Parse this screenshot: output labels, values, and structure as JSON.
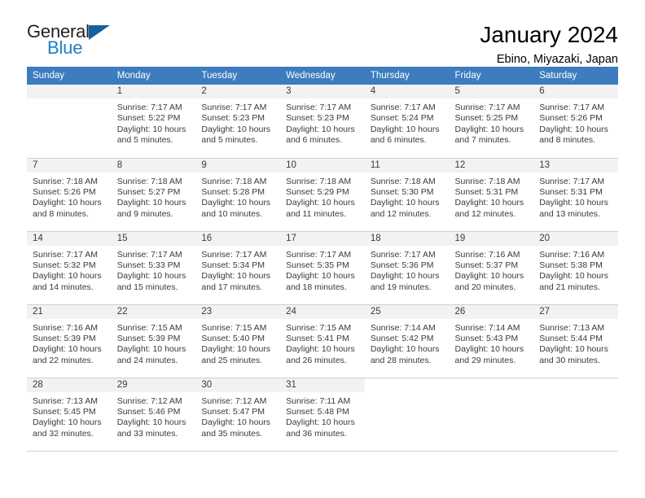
{
  "brand": {
    "word_one": "General",
    "word_two": "Blue",
    "triangle_icon": "triangle-icon"
  },
  "header": {
    "title": "January 2024",
    "subtitle": "Ebino, Miyazaki, Japan"
  },
  "colors": {
    "header_blue": "#3d7cbf",
    "brand_blue": "#1f7fc4",
    "brand_dark": "#231f20",
    "daynum_band": "#f2f2f2",
    "grid_line": "#cfcfcf",
    "text": "#3a3a3a"
  },
  "weekday_headers": [
    "Sunday",
    "Monday",
    "Tuesday",
    "Wednesday",
    "Thursday",
    "Friday",
    "Saturday"
  ],
  "labels": {
    "sunrise_prefix": "Sunrise:",
    "sunset_prefix": "Sunset:",
    "daylight_prefix": "Daylight:"
  },
  "weeks": [
    [
      {
        "day": "",
        "blank": true,
        "sunrise": "",
        "sunset": "",
        "daylight_line1": "",
        "daylight_line2": ""
      },
      {
        "day": "1",
        "sunrise": "Sunrise: 7:17 AM",
        "sunset": "Sunset: 5:22 PM",
        "daylight_line1": "Daylight: 10 hours",
        "daylight_line2": "and 5 minutes."
      },
      {
        "day": "2",
        "sunrise": "Sunrise: 7:17 AM",
        "sunset": "Sunset: 5:23 PM",
        "daylight_line1": "Daylight: 10 hours",
        "daylight_line2": "and 5 minutes."
      },
      {
        "day": "3",
        "sunrise": "Sunrise: 7:17 AM",
        "sunset": "Sunset: 5:23 PM",
        "daylight_line1": "Daylight: 10 hours",
        "daylight_line2": "and 6 minutes."
      },
      {
        "day": "4",
        "sunrise": "Sunrise: 7:17 AM",
        "sunset": "Sunset: 5:24 PM",
        "daylight_line1": "Daylight: 10 hours",
        "daylight_line2": "and 6 minutes."
      },
      {
        "day": "5",
        "sunrise": "Sunrise: 7:17 AM",
        "sunset": "Sunset: 5:25 PM",
        "daylight_line1": "Daylight: 10 hours",
        "daylight_line2": "and 7 minutes."
      },
      {
        "day": "6",
        "sunrise": "Sunrise: 7:17 AM",
        "sunset": "Sunset: 5:26 PM",
        "daylight_line1": "Daylight: 10 hours",
        "daylight_line2": "and 8 minutes."
      }
    ],
    [
      {
        "day": "7",
        "sunrise": "Sunrise: 7:18 AM",
        "sunset": "Sunset: 5:26 PM",
        "daylight_line1": "Daylight: 10 hours",
        "daylight_line2": "and 8 minutes."
      },
      {
        "day": "8",
        "sunrise": "Sunrise: 7:18 AM",
        "sunset": "Sunset: 5:27 PM",
        "daylight_line1": "Daylight: 10 hours",
        "daylight_line2": "and 9 minutes."
      },
      {
        "day": "9",
        "sunrise": "Sunrise: 7:18 AM",
        "sunset": "Sunset: 5:28 PM",
        "daylight_line1": "Daylight: 10 hours",
        "daylight_line2": "and 10 minutes."
      },
      {
        "day": "10",
        "sunrise": "Sunrise: 7:18 AM",
        "sunset": "Sunset: 5:29 PM",
        "daylight_line1": "Daylight: 10 hours",
        "daylight_line2": "and 11 minutes."
      },
      {
        "day": "11",
        "sunrise": "Sunrise: 7:18 AM",
        "sunset": "Sunset: 5:30 PM",
        "daylight_line1": "Daylight: 10 hours",
        "daylight_line2": "and 12 minutes."
      },
      {
        "day": "12",
        "sunrise": "Sunrise: 7:18 AM",
        "sunset": "Sunset: 5:31 PM",
        "daylight_line1": "Daylight: 10 hours",
        "daylight_line2": "and 12 minutes."
      },
      {
        "day": "13",
        "sunrise": "Sunrise: 7:17 AM",
        "sunset": "Sunset: 5:31 PM",
        "daylight_line1": "Daylight: 10 hours",
        "daylight_line2": "and 13 minutes."
      }
    ],
    [
      {
        "day": "14",
        "sunrise": "Sunrise: 7:17 AM",
        "sunset": "Sunset: 5:32 PM",
        "daylight_line1": "Daylight: 10 hours",
        "daylight_line2": "and 14 minutes."
      },
      {
        "day": "15",
        "sunrise": "Sunrise: 7:17 AM",
        "sunset": "Sunset: 5:33 PM",
        "daylight_line1": "Daylight: 10 hours",
        "daylight_line2": "and 15 minutes."
      },
      {
        "day": "16",
        "sunrise": "Sunrise: 7:17 AM",
        "sunset": "Sunset: 5:34 PM",
        "daylight_line1": "Daylight: 10 hours",
        "daylight_line2": "and 17 minutes."
      },
      {
        "day": "17",
        "sunrise": "Sunrise: 7:17 AM",
        "sunset": "Sunset: 5:35 PM",
        "daylight_line1": "Daylight: 10 hours",
        "daylight_line2": "and 18 minutes."
      },
      {
        "day": "18",
        "sunrise": "Sunrise: 7:17 AM",
        "sunset": "Sunset: 5:36 PM",
        "daylight_line1": "Daylight: 10 hours",
        "daylight_line2": "and 19 minutes."
      },
      {
        "day": "19",
        "sunrise": "Sunrise: 7:16 AM",
        "sunset": "Sunset: 5:37 PM",
        "daylight_line1": "Daylight: 10 hours",
        "daylight_line2": "and 20 minutes."
      },
      {
        "day": "20",
        "sunrise": "Sunrise: 7:16 AM",
        "sunset": "Sunset: 5:38 PM",
        "daylight_line1": "Daylight: 10 hours",
        "daylight_line2": "and 21 minutes."
      }
    ],
    [
      {
        "day": "21",
        "sunrise": "Sunrise: 7:16 AM",
        "sunset": "Sunset: 5:39 PM",
        "daylight_line1": "Daylight: 10 hours",
        "daylight_line2": "and 22 minutes."
      },
      {
        "day": "22",
        "sunrise": "Sunrise: 7:15 AM",
        "sunset": "Sunset: 5:39 PM",
        "daylight_line1": "Daylight: 10 hours",
        "daylight_line2": "and 24 minutes."
      },
      {
        "day": "23",
        "sunrise": "Sunrise: 7:15 AM",
        "sunset": "Sunset: 5:40 PM",
        "daylight_line1": "Daylight: 10 hours",
        "daylight_line2": "and 25 minutes."
      },
      {
        "day": "24",
        "sunrise": "Sunrise: 7:15 AM",
        "sunset": "Sunset: 5:41 PM",
        "daylight_line1": "Daylight: 10 hours",
        "daylight_line2": "and 26 minutes."
      },
      {
        "day": "25",
        "sunrise": "Sunrise: 7:14 AM",
        "sunset": "Sunset: 5:42 PM",
        "daylight_line1": "Daylight: 10 hours",
        "daylight_line2": "and 28 minutes."
      },
      {
        "day": "26",
        "sunrise": "Sunrise: 7:14 AM",
        "sunset": "Sunset: 5:43 PM",
        "daylight_line1": "Daylight: 10 hours",
        "daylight_line2": "and 29 minutes."
      },
      {
        "day": "27",
        "sunrise": "Sunrise: 7:13 AM",
        "sunset": "Sunset: 5:44 PM",
        "daylight_line1": "Daylight: 10 hours",
        "daylight_line2": "and 30 minutes."
      }
    ],
    [
      {
        "day": "28",
        "sunrise": "Sunrise: 7:13 AM",
        "sunset": "Sunset: 5:45 PM",
        "daylight_line1": "Daylight: 10 hours",
        "daylight_line2": "and 32 minutes."
      },
      {
        "day": "29",
        "sunrise": "Sunrise: 7:12 AM",
        "sunset": "Sunset: 5:46 PM",
        "daylight_line1": "Daylight: 10 hours",
        "daylight_line2": "and 33 minutes."
      },
      {
        "day": "30",
        "sunrise": "Sunrise: 7:12 AM",
        "sunset": "Sunset: 5:47 PM",
        "daylight_line1": "Daylight: 10 hours",
        "daylight_line2": "and 35 minutes."
      },
      {
        "day": "31",
        "sunrise": "Sunrise: 7:11 AM",
        "sunset": "Sunset: 5:48 PM",
        "daylight_line1": "Daylight: 10 hours",
        "daylight_line2": "and 36 minutes."
      },
      {
        "day": "",
        "blank": true,
        "sunrise": "",
        "sunset": "",
        "daylight_line1": "",
        "daylight_line2": ""
      },
      {
        "day": "",
        "blank": true,
        "sunrise": "",
        "sunset": "",
        "daylight_line1": "",
        "daylight_line2": ""
      },
      {
        "day": "",
        "blank": true,
        "sunrise": "",
        "sunset": "",
        "daylight_line1": "",
        "daylight_line2": ""
      }
    ]
  ]
}
